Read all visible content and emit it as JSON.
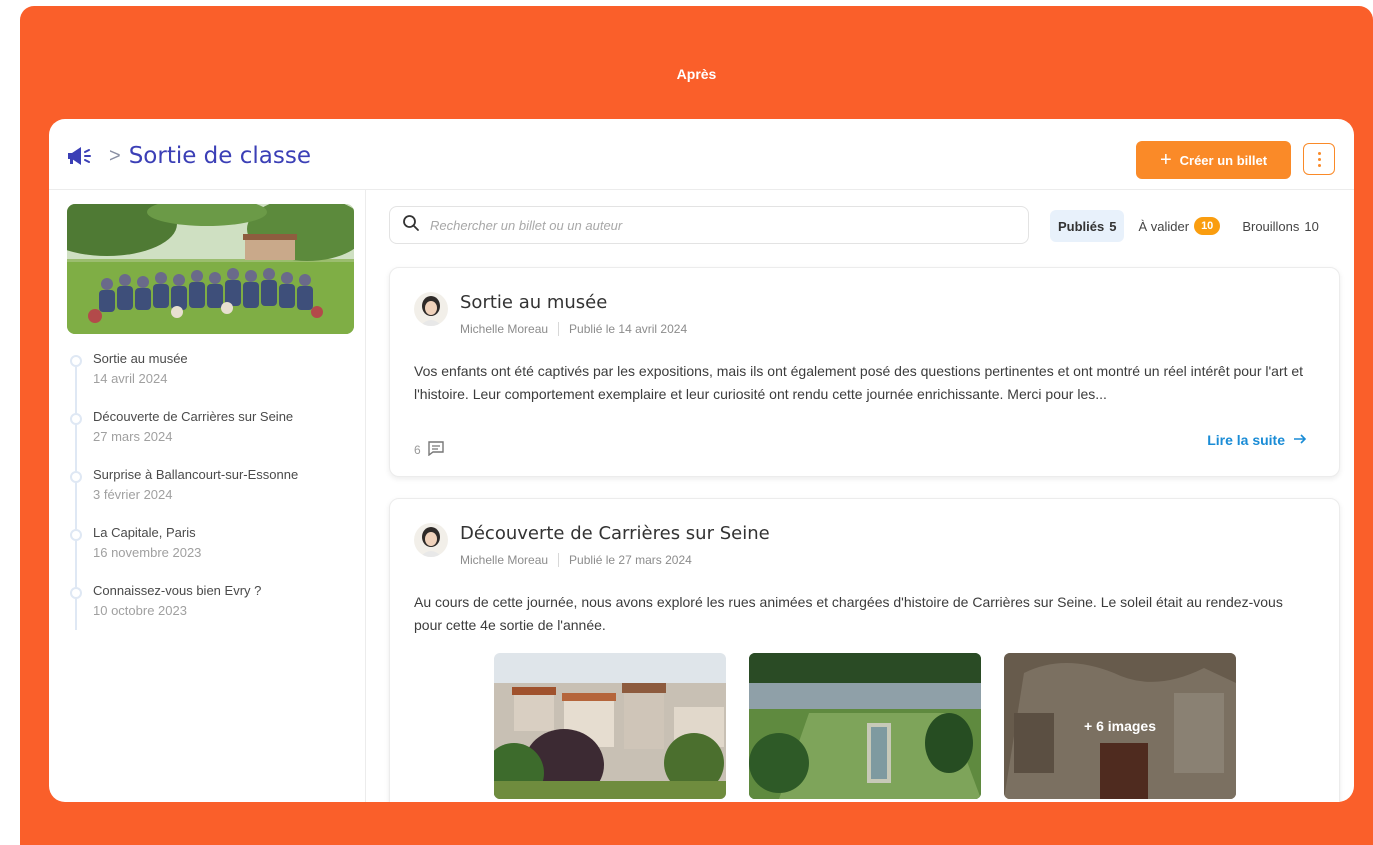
{
  "frame_title": "Après",
  "header": {
    "title": "Sortie de classe",
    "separator": ">",
    "create_button": "Créer un billet",
    "create_icon": "plus-icon",
    "more_icon": "kebab-menu-icon"
  },
  "sidebar": {
    "items": [
      {
        "title": "Sortie au musée",
        "date": "14 avril 2024"
      },
      {
        "title": "Découverte de Carrières sur Seine",
        "date": "27 mars 2024"
      },
      {
        "title": "Surprise à Ballancourt-sur-Essonne",
        "date": "3 février 2024"
      },
      {
        "title": "La Capitale, Paris",
        "date": "16 novembre 2023"
      },
      {
        "title": "Connaissez-vous bien Evry ?",
        "date": "10 octobre 2023"
      }
    ]
  },
  "search": {
    "placeholder": "Rechercher un billet ou un auteur"
  },
  "filters": {
    "published_label": "Publiés",
    "published_count": "5",
    "to_validate_label": "À valider",
    "to_validate_count": "10",
    "drafts_label": "Brouillons",
    "drafts_count": "10"
  },
  "posts": [
    {
      "title": "Sortie au musée",
      "author": "Michelle Moreau",
      "published": "Publié le 14 avril 2024",
      "text": "Vos enfants ont été captivés par les expositions, mais ils ont également posé des questions pertinentes et ont montré un réel intérêt pour l'art et l'histoire. Leur comportement exemplaire et leur curiosité ont rendu cette journée enrichissante. Merci pour les...",
      "comments": "6",
      "read_more": "Lire la suite"
    },
    {
      "title": "Découverte de Carrières sur Seine",
      "author": "Michelle Moreau",
      "published": "Publié le 27 mars 2024",
      "text": "Au cours de cette journée, nous avons exploré les rues animées et chargées d'histoire de Carrières sur Seine. Le soleil était au rendez-vous pour cette 4e sortie de l'année.",
      "more_images": "+ 6 images"
    }
  ],
  "colors": {
    "frame": "#fa5f2a",
    "accent": "#fa8a28",
    "title": "#3b3fb6",
    "link": "#1a8cd6",
    "badge": "#fa9d0f"
  }
}
